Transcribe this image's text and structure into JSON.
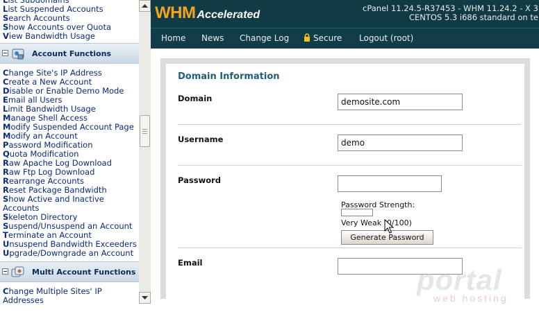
{
  "sidebar": {
    "top_links": [
      {
        "initial": "L",
        "rest": "ist Subdomains"
      },
      {
        "initial": "L",
        "rest": "ist Suspended Accounts"
      },
      {
        "initial": "S",
        "rest": "earch Accounts"
      },
      {
        "initial": "S",
        "rest": "how Accounts over Quota"
      },
      {
        "initial": "V",
        "rest": "iew Bandwidth Usage"
      }
    ],
    "account_functions": {
      "title": "Account Functions",
      "links": [
        {
          "initial": "C",
          "rest": "hange Site's IP Address"
        },
        {
          "initial": "C",
          "rest": "reate a New Account"
        },
        {
          "initial": "D",
          "rest": "isable or Enable Demo Mode"
        },
        {
          "initial": "E",
          "rest": "mail all Users"
        },
        {
          "initial": "L",
          "rest": "imit Bandwidth Usage"
        },
        {
          "initial": "M",
          "rest": "anage Shell Access"
        },
        {
          "initial": "M",
          "rest": "odify Suspended Account Page"
        },
        {
          "initial": "M",
          "rest": "odify an Account"
        },
        {
          "initial": "P",
          "rest": "assword Modification"
        },
        {
          "initial": "Q",
          "rest": "uota Modification"
        },
        {
          "initial": "R",
          "rest": "aw Apache Log Download"
        },
        {
          "initial": "R",
          "rest": "aw Ftp Log Download"
        },
        {
          "initial": "R",
          "rest": "earrange Accounts"
        },
        {
          "initial": "R",
          "rest": "eset Package Bandwidth"
        },
        {
          "initial": "S",
          "rest": "how Active and Inactive Accounts"
        },
        {
          "initial": "S",
          "rest": "keleton Directory"
        },
        {
          "initial": "S",
          "rest": "uspend/Unsuspend an Account"
        },
        {
          "initial": "T",
          "rest": "erminate an Account"
        },
        {
          "initial": "U",
          "rest": "nsuspend Bandwidth Exceeders"
        },
        {
          "initial": "U",
          "rest": "pgrade/Downgrade an Account"
        }
      ]
    },
    "multi_account_functions": {
      "title": "Multi Account Functions",
      "links": [
        {
          "initial": "C",
          "rest": "hange Multiple Sites' IP Addresses"
        }
      ]
    }
  },
  "header": {
    "logo_main": "WHM",
    "logo_sub": "Accelerated",
    "version_line1": "cPanel 11.24.5-R37453 - WHM 11.24.2 - X 3",
    "version_line2": "CENTOS 5.3 i686 standard on te"
  },
  "nav": {
    "home": "Home",
    "news": "News",
    "changelog": "Change Log",
    "secure": "Secure",
    "logout": "Logout (root)"
  },
  "form": {
    "title": "Domain Information",
    "domain_label": "Domain",
    "domain_value": "demosite.com",
    "username_label": "Username",
    "username_value": "demo",
    "password_label": "Password",
    "password_value": "",
    "strength_label": "Password Strength:",
    "strength_text": "Very Weak (0/100)",
    "strength_value": 0,
    "generate_button": "Generate Password",
    "email_label": "Email",
    "email_value": ""
  },
  "watermark": {
    "brand": "portal",
    "sub": "web hosting"
  },
  "colors": {
    "header_bg": "#103a44",
    "logo_orange": "#f2a51c",
    "link_blue": "#0b2a7a",
    "title_teal": "#1f5f7a"
  }
}
